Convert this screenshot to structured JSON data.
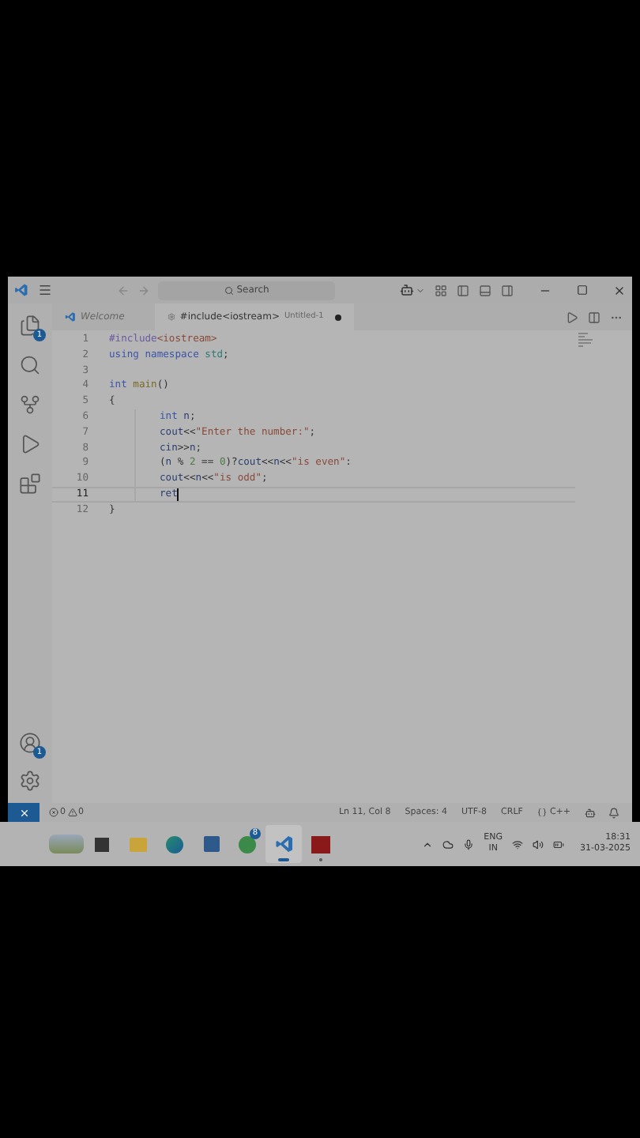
{
  "title_bar": {
    "search_placeholder": "Search"
  },
  "tabs": [
    {
      "kind": "welcome",
      "label": "Welcome",
      "selected": false,
      "modified": false
    },
    {
      "kind": "file",
      "label": "#include<iostream>",
      "detail": "Untitled-1",
      "selected": true,
      "modified": true
    }
  ],
  "activity_bar": {
    "top": [
      {
        "kind": "explorer",
        "badge": "1"
      },
      {
        "kind": "search"
      },
      {
        "kind": "source-control"
      },
      {
        "kind": "run"
      },
      {
        "kind": "extensions"
      }
    ],
    "bottom": [
      {
        "kind": "accounts",
        "badge": "1"
      },
      {
        "kind": "settings"
      }
    ]
  },
  "editor": {
    "lines": [
      {
        "number": "1",
        "current": false,
        "tokens": [
          {
            "kind": "preprocessor",
            "text": "#include"
          },
          {
            "kind": "string",
            "text": "<iostream>"
          }
        ]
      },
      {
        "number": "2",
        "current": false,
        "tokens": [
          {
            "kind": "keyword",
            "text": "using namespace "
          },
          {
            "kind": "type",
            "text": "std"
          },
          {
            "kind": "plain",
            "text": ";"
          }
        ]
      },
      {
        "number": "3",
        "current": false
      },
      {
        "number": "4",
        "current": false,
        "tokens": [
          {
            "kind": "keyword",
            "text": "int "
          },
          {
            "kind": "function",
            "text": "main"
          },
          {
            "kind": "plain",
            "text": "()"
          }
        ]
      },
      {
        "number": "5",
        "current": false,
        "tokens": [
          {
            "kind": "plain",
            "text": "{"
          }
        ]
      },
      {
        "number": "6",
        "current": false,
        "indent": true,
        "tokens": [
          {
            "kind": "keyword",
            "text": "int"
          },
          {
            "kind": "variable",
            "text": " n"
          },
          {
            "kind": "plain",
            "text": ";"
          }
        ]
      },
      {
        "number": "7",
        "current": false,
        "indent": true,
        "tokens": [
          {
            "kind": "variable",
            "text": "cout"
          },
          {
            "kind": "plain",
            "text": "<<"
          },
          {
            "kind": "string",
            "text": "\"Enter the number:\""
          },
          {
            "kind": "plain",
            "text": ";"
          }
        ]
      },
      {
        "number": "8",
        "current": false,
        "indent": true,
        "tokens": [
          {
            "kind": "variable",
            "text": "cin"
          },
          {
            "kind": "plain",
            "text": ">>"
          },
          {
            "kind": "variable",
            "text": "n"
          },
          {
            "kind": "plain",
            "text": ";"
          }
        ]
      },
      {
        "number": "9",
        "current": false,
        "indent": true,
        "tokens": [
          {
            "kind": "plain",
            "text": "("
          },
          {
            "kind": "variable",
            "text": "n"
          },
          {
            "kind": "plain",
            "text": " % "
          },
          {
            "kind": "number",
            "text": "2"
          },
          {
            "kind": "plain",
            "text": " == "
          },
          {
            "kind": "number",
            "text": "0"
          },
          {
            "kind": "plain",
            "text": ")?"
          },
          {
            "kind": "variable",
            "text": "cout"
          },
          {
            "kind": "plain",
            "text": "<<"
          },
          {
            "kind": "variable",
            "text": "n"
          },
          {
            "kind": "plain",
            "text": "<<"
          },
          {
            "kind": "string",
            "text": "\"is even\""
          },
          {
            "kind": "plain",
            "text": ":"
          }
        ]
      },
      {
        "number": "10",
        "current": false,
        "indent": true,
        "tokens": [
          {
            "kind": "variable",
            "text": "cout"
          },
          {
            "kind": "plain",
            "text": "<<"
          },
          {
            "kind": "variable",
            "text": "n"
          },
          {
            "kind": "plain",
            "text": "<<"
          },
          {
            "kind": "string",
            "text": "\"is odd\""
          },
          {
            "kind": "plain",
            "text": ";"
          }
        ]
      },
      {
        "number": "11",
        "current": true,
        "indent": true,
        "tokens": [
          {
            "kind": "variable",
            "text": "ret"
          }
        ]
      },
      {
        "number": "12",
        "current": false,
        "tokens": [
          {
            "kind": "plain",
            "text": "}"
          }
        ]
      }
    ]
  },
  "status_bar": {
    "errors": "0",
    "warnings": "0",
    "items": [
      "Ln 11, Col 8",
      "Spaces: 4",
      "UTF-8",
      "CRLF"
    ],
    "language": "C++"
  },
  "taskbar": {
    "apps": [
      {
        "kind": "widgets",
        "selected": false
      },
      {
        "kind": "task-view",
        "selected": false
      },
      {
        "kind": "file-explorer",
        "selected": false
      },
      {
        "kind": "browser",
        "selected": false
      },
      {
        "kind": "store",
        "selected": false
      },
      {
        "kind": "chat",
        "selected": false,
        "badge": "8"
      },
      {
        "kind": "code-editor",
        "selected": true
      },
      {
        "kind": "recorder",
        "selected": false,
        "running": true
      }
    ],
    "language": "ENG",
    "region": "IN",
    "time": "18:31",
    "date": "31-03-2025"
  }
}
